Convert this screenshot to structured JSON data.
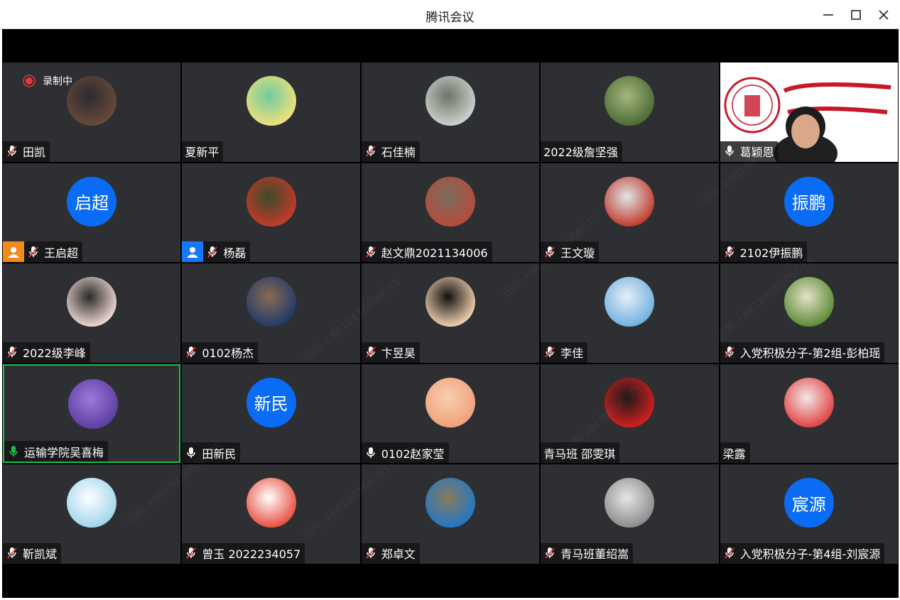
{
  "window": {
    "title": "腾讯会议",
    "recording_label": "录制中",
    "watermark_text": "田凯 +8618438606575"
  },
  "colors": {
    "host_orange": "#f28a1c",
    "cohost_blue": "#1677ff",
    "avatar_blue": "#0a6cf5",
    "speaking_green": "#19c14a",
    "record_red": "#e53935"
  },
  "participants": [
    {
      "name": "田凯",
      "mic": "muted",
      "avatar": "photo-man-sitting-icon",
      "photo_colors": [
        "#6b4a3a",
        "#2a2a30"
      ]
    },
    {
      "name": "夏新平",
      "mic": "none",
      "avatar": "anime-girl-icon",
      "photo_colors": [
        "#f1e27a",
        "#6fc9a0"
      ]
    },
    {
      "name": "石佳楠",
      "mic": "muted",
      "avatar": "white-rabbit-photo-icon",
      "photo_colors": [
        "#cfd3cf",
        "#6b7568"
      ]
    },
    {
      "name": "2022级詹坚强",
      "mic": "none",
      "avatar": "forest-photo-icon",
      "photo_colors": [
        "#4b6a35",
        "#a3b77a"
      ]
    },
    {
      "name": "葛颖恩",
      "mic": "on-white",
      "avatar": "university-video-feed",
      "photo_colors": [
        "#ffffff",
        "#c7182a"
      ]
    },
    {
      "name": "王启超",
      "mic": "muted",
      "role": "host",
      "avatar_text": "启超"
    },
    {
      "name": "杨磊",
      "mic": "muted",
      "role": "cohost",
      "avatar": "child-photo-icon",
      "photo_colors": [
        "#c73a2a",
        "#3a4a2a"
      ]
    },
    {
      "name": "赵文鼎2021134006",
      "mic": "muted",
      "avatar": "red-car-photo-icon",
      "photo_colors": [
        "#b84a3a",
        "#7a6e5e"
      ]
    },
    {
      "name": "王文璇",
      "mic": "muted",
      "avatar": "kid-red-hat-photo-icon",
      "photo_colors": [
        "#c0392b",
        "#dfe6e9"
      ]
    },
    {
      "name": "2102伊振鹏",
      "mic": "muted",
      "avatar_text": "振鹏"
    },
    {
      "name": "2022级李峰",
      "mic": "muted",
      "avatar": "anime-sleeping-icon",
      "photo_colors": [
        "#f2dcd5",
        "#2a2a2a"
      ]
    },
    {
      "name": "0102杨杰",
      "mic": "muted",
      "avatar": "basketball-player-photo-icon",
      "photo_colors": [
        "#1e3a6a",
        "#8a6a52"
      ]
    },
    {
      "name": "卞昱昊",
      "mic": "muted",
      "avatar": "smiling-child-photo-icon",
      "photo_colors": [
        "#f3d3b0",
        "#111111"
      ]
    },
    {
      "name": "李佳",
      "mic": "muted",
      "avatar": "boy-sky-photo-icon",
      "photo_colors": [
        "#6fb0e0",
        "#e7eef5"
      ]
    },
    {
      "name": "入党积极分子-第2组-彭柏瑶",
      "mic": "muted",
      "avatar": "alpaca-photo-icon",
      "photo_colors": [
        "#5a8a35",
        "#e6e0c8"
      ]
    },
    {
      "name": "运输学院吴喜梅",
      "mic": "on-green",
      "active": true,
      "avatar": "purple-flowers-photo-icon",
      "photo_colors": [
        "#5b3da0",
        "#9b7ad8"
      ]
    },
    {
      "name": "田新民",
      "mic": "on-white",
      "avatar_text": "新民"
    },
    {
      "name": "0102赵家莹",
      "mic": "on-white",
      "avatar": "peach-face-art-icon",
      "photo_colors": [
        "#f2a07a",
        "#f5d0b0"
      ]
    },
    {
      "name": "青马班 邵雯琪",
      "mic": "none",
      "avatar": "red-dress-photo-icon",
      "photo_colors": [
        "#d61f1f",
        "#1a1a1a"
      ]
    },
    {
      "name": "梁露",
      "mic": "none",
      "avatar": "anime-girl-red-icon",
      "photo_colors": [
        "#e04040",
        "#f3e8e8"
      ]
    },
    {
      "name": "靳凯斌",
      "mic": "muted",
      "avatar": "anime-boy-blue-hair-icon",
      "photo_colors": [
        "#9fd4ec",
        "#ffffff"
      ]
    },
    {
      "name": "曾玉 2022234057",
      "mic": "muted",
      "avatar": "cartoon-bear-icon",
      "photo_colors": [
        "#e74c3c",
        "#ffffff"
      ]
    },
    {
      "name": "郑卓文",
      "mic": "muted",
      "avatar": "doraemon-dog-icon",
      "photo_colors": [
        "#1f78c8",
        "#8a7a5a"
      ]
    },
    {
      "name": "青马班董绍嵩",
      "mic": "muted",
      "avatar": "anime-girl-grey-icon",
      "photo_colors": [
        "#8a8a8a",
        "#e6e6e6"
      ]
    },
    {
      "name": "入党积极分子-第4组-刘宸源",
      "mic": "muted",
      "avatar_text": "宸源"
    }
  ]
}
